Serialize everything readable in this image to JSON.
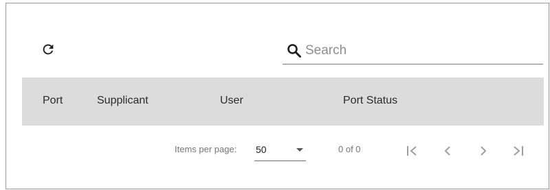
{
  "toolbar": {
    "refresh_icon": "refresh-icon",
    "search_icon": "search-icon",
    "search_placeholder": "Search",
    "search_value": ""
  },
  "table": {
    "columns": [
      "Port",
      "Supplicant",
      "User",
      "Port Status"
    ],
    "header_bg": "#dcdcdc",
    "rows": []
  },
  "paginator": {
    "items_per_page_label": "Items per page:",
    "page_size": "50",
    "range_label": "0 of 0",
    "buttons": [
      "first-page",
      "previous-page",
      "next-page",
      "last-page"
    ]
  }
}
